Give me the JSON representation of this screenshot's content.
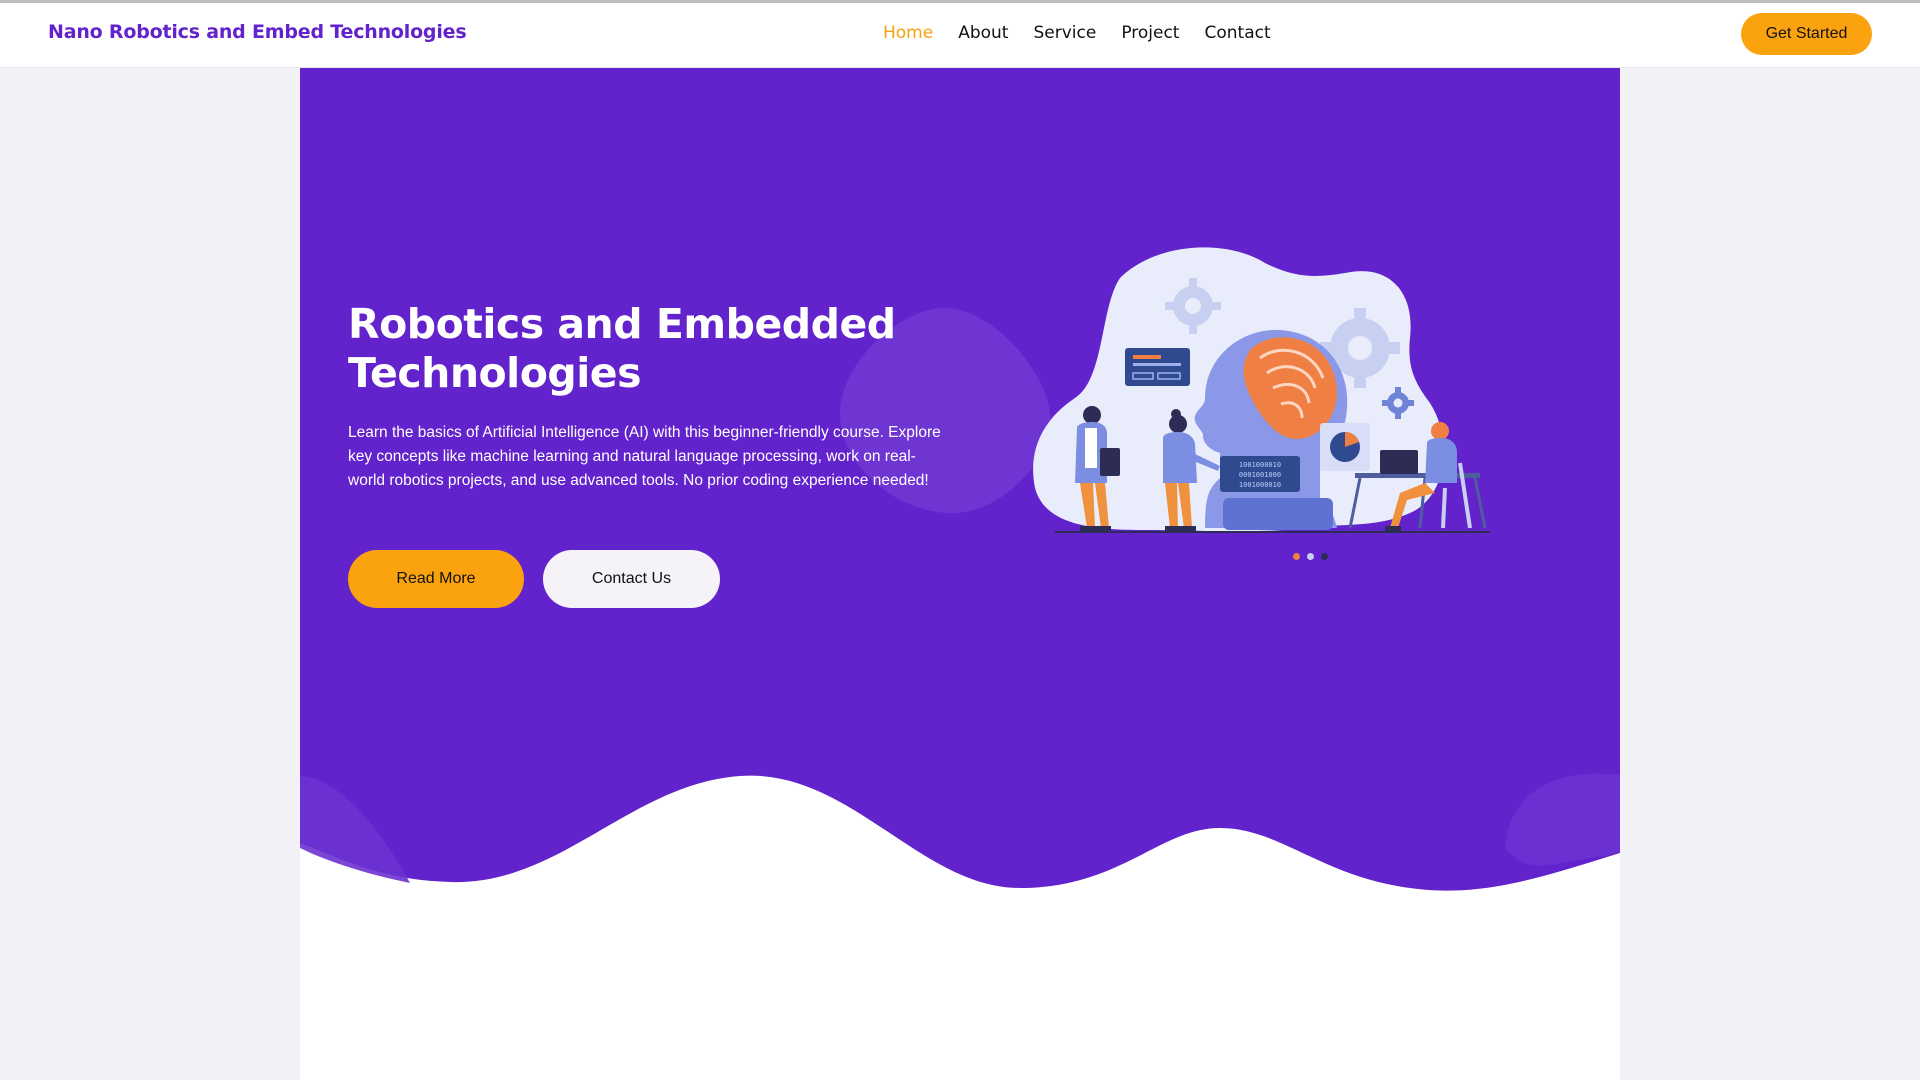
{
  "header": {
    "brand": "Nano Robotics and Embed Technologies",
    "nav": [
      {
        "label": "Home",
        "active": true
      },
      {
        "label": "About",
        "active": false
      },
      {
        "label": "Service",
        "active": false
      },
      {
        "label": "Project",
        "active": false
      },
      {
        "label": "Contact",
        "active": false
      }
    ],
    "cta_label": "Get Started"
  },
  "hero": {
    "title_line1": "Robotics and Embedded",
    "title_line2": "Technologies",
    "description": "Learn the basics of Artificial Intelligence (AI) with this beginner-friendly course. Explore key concepts like machine learning and natural language processing, work on real-world robotics projects, and use advanced tools. No prior coding experience needed!",
    "primary_button": "Read More",
    "secondary_button": "Contact Us",
    "illustration_code": [
      "1001000010",
      "0001001000",
      "1001000010"
    ],
    "carousel_dots": 3,
    "carousel_active": 2
  },
  "colors": {
    "brand": "#6222cc",
    "accent": "#fba30f",
    "hero_bg": "#6222cc",
    "nav_active": "#f7a00e"
  },
  "icons": [
    "gear-icon",
    "pie-chart-icon",
    "ai-head-illustration"
  ]
}
